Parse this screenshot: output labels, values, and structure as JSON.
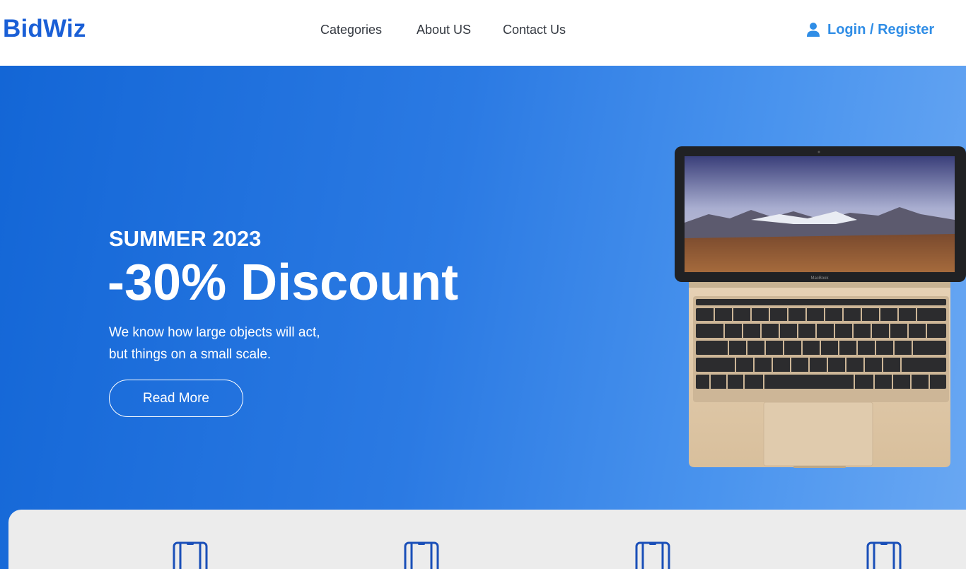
{
  "brand": {
    "name": "BidWiz",
    "color": "#1a5fd6"
  },
  "nav": {
    "links": [
      {
        "label": "Categories"
      },
      {
        "label": "About US"
      },
      {
        "label": "Contact Us"
      }
    ],
    "login": {
      "label": "Login / Register",
      "icon": "user-icon",
      "color": "#2f8de6"
    }
  },
  "hero": {
    "eyebrow": "SUMMER 2023",
    "title": "-30% Discount",
    "description_lines": [
      "We know how large objects will act,",
      "but things on a small scale."
    ],
    "cta_label": "Read More",
    "image": "laptop-image"
  },
  "categories": {
    "items": [
      {
        "icon": "smartphone-icon"
      },
      {
        "icon": "smartphone-icon"
      },
      {
        "icon": "smartphone-icon"
      },
      {
        "icon": "smartphone-icon"
      }
    ]
  },
  "colors": {
    "accent": "#1a5fd6",
    "hero_gradient_start": "#1366d6",
    "hero_gradient_end": "#6aa8f3"
  }
}
